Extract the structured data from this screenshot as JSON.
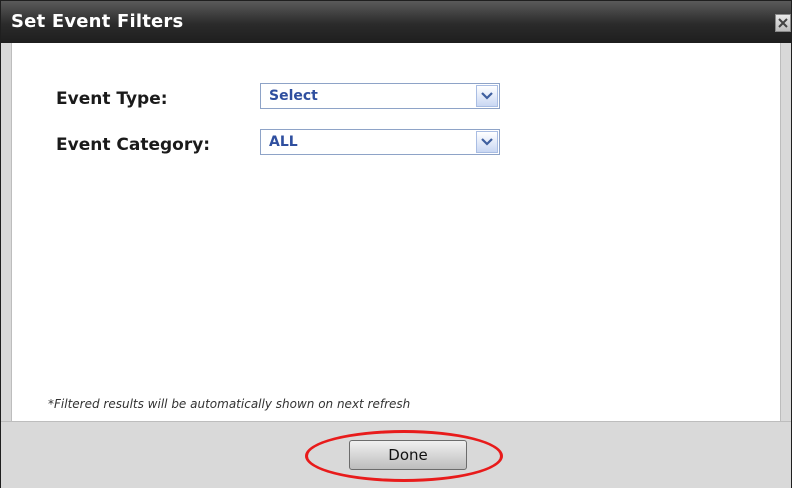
{
  "dialog": {
    "title": "Set Event Filters",
    "close_icon": "close-icon"
  },
  "filters": {
    "event_type": {
      "label": "Event Type:",
      "selected": "Select"
    },
    "event_category": {
      "label": "Event Category:",
      "selected": "ALL"
    }
  },
  "footnote": "*Filtered results will be automatically shown on next refresh",
  "footer": {
    "done_label": "Done"
  },
  "colors": {
    "titlebar": "#2b2b2b",
    "select_text": "#2f4f9f",
    "select_border": "#8ea3c7",
    "highlight": "#e81b1b"
  },
  "icons": {
    "dropdown": "chevron-down-icon"
  }
}
